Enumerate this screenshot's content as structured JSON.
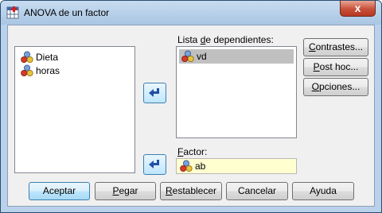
{
  "window": {
    "title": "ANOVA de un factor",
    "close_glyph": "x"
  },
  "source_list": {
    "items": [
      "Dieta",
      "horas"
    ]
  },
  "dependents": {
    "label_pre": "Lista ",
    "label_key": "d",
    "label_post": "e dependientes:",
    "items": [
      "vd"
    ]
  },
  "factor": {
    "label_pre": "",
    "label_key": "F",
    "label_post": "actor:",
    "value": "ab"
  },
  "side_buttons": [
    {
      "pre": "",
      "key": "C",
      "post": "ontrastes..."
    },
    {
      "pre": "",
      "key": "P",
      "post": "ost hoc..."
    },
    {
      "pre": "",
      "key": "O",
      "post": "pciones..."
    }
  ],
  "bottom_buttons": [
    {
      "pre": "Aceptar",
      "key": "",
      "post": ""
    },
    {
      "pre": "",
      "key": "P",
      "post": "egar"
    },
    {
      "pre": "",
      "key": "R",
      "post": "establecer"
    },
    {
      "pre": "Cancelar",
      "key": "",
      "post": ""
    },
    {
      "pre": "Ayuda",
      "key": "",
      "post": ""
    }
  ],
  "colors": {
    "accent": "#3c7fb1",
    "arrow_fill": "#1f4fa8",
    "factor_bg": "#ffffd0",
    "selection": "#c0c0c0",
    "close": "#c7503a"
  },
  "icons": {
    "variable": "scale-variable-icon",
    "arrow": "move-arrow-icon",
    "app": "anova-app-icon"
  }
}
